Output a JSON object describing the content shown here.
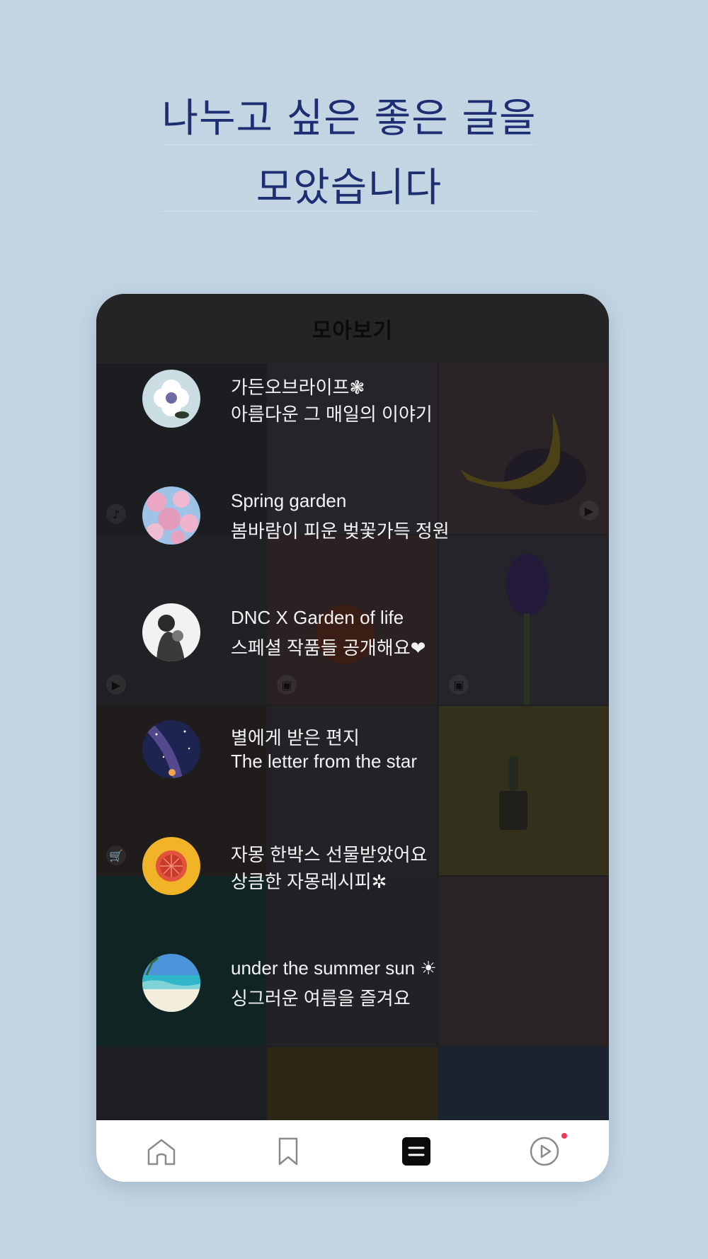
{
  "headline": {
    "line1": "나누고 싶은 좋은 글을",
    "line2": "모았습니다"
  },
  "app": {
    "title": "모아보기"
  },
  "colors": {
    "background": "#c3d5e3",
    "headline": "#1d2f72",
    "notification": "#ef3b55"
  },
  "feed": [
    {
      "title": "가든오브라이프❃",
      "subtitle": "아름다운 그 매일의 이야기",
      "avatar": "white-flower"
    },
    {
      "title": "Spring garden",
      "subtitle": "봄바람이 피운 벚꽃가득 정원",
      "avatar": "cherry-blossom"
    },
    {
      "title": "DNC X Garden of life",
      "subtitle": "스페셜 작품들 공개해요❤",
      "avatar": "mother-and-child"
    },
    {
      "title": "별에게 받은 편지",
      "subtitle": "The letter from the star",
      "avatar": "milky-way"
    },
    {
      "title": "자몽 한박스 선물받았어요",
      "subtitle": "상큼한 자몽레시피✲",
      "avatar": "grapefruit"
    },
    {
      "title": "under the summer sun ☀",
      "subtitle": "싱그러운 여름을 즐겨요",
      "avatar": "beach"
    }
  ],
  "grid_badges": [
    "music-note-icon",
    "play-icon",
    "image-icon",
    "cart-icon"
  ],
  "tabs": [
    "home-icon",
    "bookmark-icon",
    "menu-icon",
    "play-circle-icon"
  ]
}
